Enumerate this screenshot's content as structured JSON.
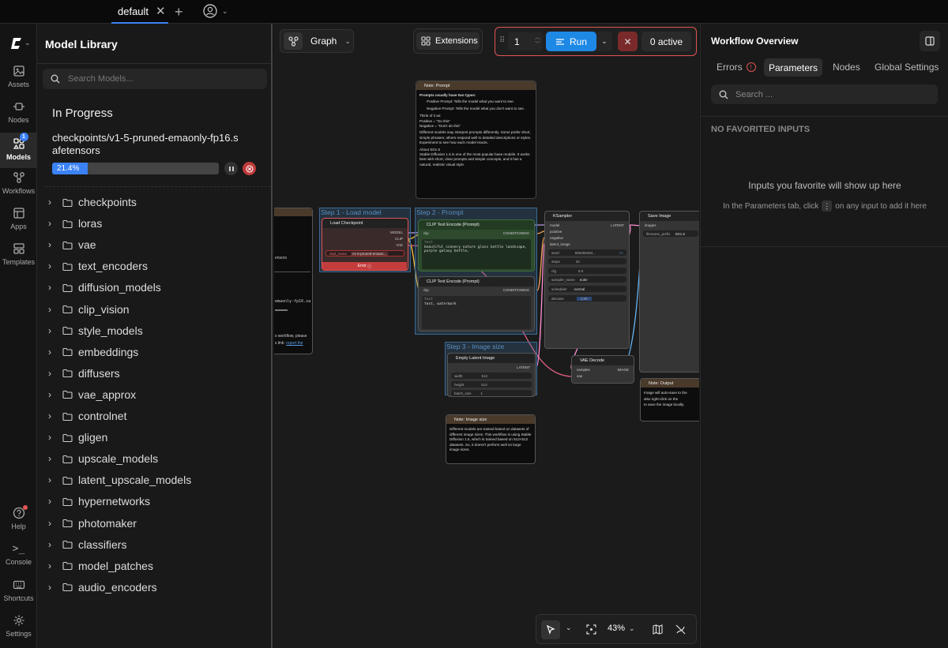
{
  "tabbar": {
    "tab": "default"
  },
  "rail": {
    "items": [
      {
        "label": "Assets",
        "icon": "image-icon"
      },
      {
        "label": "Nodes",
        "icon": "node-icon"
      },
      {
        "label": "Models",
        "icon": "models-icon",
        "badge": "1"
      },
      {
        "label": "Workflows",
        "icon": "workflow-icon"
      },
      {
        "label": "Apps",
        "icon": "apps-icon"
      },
      {
        "label": "Templates",
        "icon": "templates-icon"
      }
    ],
    "bottom": [
      {
        "label": "Help",
        "icon": "help-icon"
      },
      {
        "label": "Console",
        "icon": "console-icon"
      },
      {
        "label": "Shortcuts",
        "icon": "keyboard-icon"
      },
      {
        "label": "Settings",
        "icon": "gear-icon"
      }
    ]
  },
  "library": {
    "title": "Model Library",
    "search_placeholder": "Search Models...",
    "progress_heading": "In Progress",
    "download_name": "checkpoints/v1-5-pruned-emaonly-fp16.safetensors",
    "download_percent": "21.4%",
    "download_fraction": 0.214,
    "folders": [
      "checkpoints",
      "loras",
      "vae",
      "text_encoders",
      "diffusion_models",
      "clip_vision",
      "style_models",
      "embeddings",
      "diffusers",
      "vae_approx",
      "controlnet",
      "gligen",
      "upscale_models",
      "latent_upscale_models",
      "hypernetworks",
      "photomaker",
      "classifiers",
      "model_patches",
      "audio_encoders"
    ]
  },
  "canvas": {
    "graph_label": "Graph",
    "extensions_label": "Extensions",
    "run_count": "1",
    "run_label": "Run",
    "active_label": "0 active",
    "zoom": "43%",
    "groups": {
      "g1": "Step 1 - Load model",
      "g2": "Step 2 - Prompt",
      "g3": "Step 3 - Image size"
    },
    "note_prompt": {
      "title": "Note: Prompt",
      "heading": "Prompts usually have two types:",
      "pos": "Positive Prompt: Tells the model what you want to see.",
      "neg": "Negative Prompt: Tells the model what you don't want to see.",
      "think": "Think of it as:",
      "pos2": "Positive = \"Do this\"",
      "neg2": "Negative = \"Don't do this\"",
      "body": "Different models may interpret prompts differently. Some prefer short, simple phrases; others respond well to detailed descriptions or styles. Experiment to see how each model reacts.",
      "about": "About SD1.5",
      "about_body": "Stable Diffusion 1.5 is one of the most popular base models. It works best with short, clear prompts and simple concepts, and it has a natural, realistic visual style."
    },
    "load_ckpt": {
      "title": "Load Checkpoint",
      "out1": "MODEL",
      "out2": "CLIP",
      "out3": "VAE",
      "w_label": "ckpt_name",
      "w_value": "v1-5-pruned-emaon...",
      "error": "Error"
    },
    "clip1": {
      "title": "CLIP Text Encode (Prompt)",
      "in": "clip",
      "out": "CONDITIONING",
      "text_label": "text",
      "text": "beautiful scenery nature glass bottle landscape, purple galaxy bottle,"
    },
    "clip2": {
      "title": "CLIP Text Encode (Prompt)",
      "in": "clip",
      "out": "CONDITIONING",
      "text_label": "text",
      "text": "text, watermark"
    },
    "ksampler": {
      "title": "KSampler",
      "ins": [
        "model",
        "positive",
        "negative",
        "latent_image"
      ],
      "out": "LATENT",
      "widgets": [
        [
          "seed",
          "585458484..."
        ],
        [
          "steps",
          "20"
        ],
        [
          "cfg",
          "8.0"
        ],
        [
          "sampler_name",
          "euler"
        ],
        [
          "scheduler",
          "normal"
        ],
        [
          "denoise",
          "1.00"
        ]
      ]
    },
    "save": {
      "title": "Save Image",
      "in": "images",
      "w_label": "filename_prefix",
      "w_value": "SD1.5"
    },
    "latent": {
      "title": "Empty Latent Image",
      "out": "LATENT",
      "widgets": [
        [
          "width",
          "512"
        ],
        [
          "height",
          "512"
        ],
        [
          "batch_size",
          "1"
        ]
      ]
    },
    "vae": {
      "title": "VAE Decode",
      "ins": [
        "samples",
        "vae"
      ],
      "out": "IMAGE"
    },
    "note_output": {
      "title": "Note: Output",
      "l1": "Image will auto-save to the",
      "l2": "also right-click on the",
      "l3": "to save the image locally."
    },
    "note_size": {
      "title": "Note: Image size",
      "body": "Different models are trained based on datasets of different image sizes. This workflow is using Stable Diffusion 1.5, which is trained based on 512×512 datasets. So, it doesn't perform well on large image sizes."
    },
    "partial": {
      "l1": "ensors",
      "l2": "emaonly-fp16.sa",
      "l3": "s workflow, please",
      "l4": "s link:",
      "l5": "report the"
    }
  },
  "overview": {
    "title": "Workflow Overview",
    "tabs": [
      "Errors",
      "Parameters",
      "Nodes",
      "Global Settings"
    ],
    "search_placeholder": "Search ...",
    "section": "NO FAVORITED INPUTS",
    "empty_title": "Inputs you favorite will show up here",
    "empty_hint_a": "In the Parameters tab, click",
    "empty_hint_b": "on any input to add it here"
  },
  "colors": {
    "accent": "#3b82f6",
    "run": "#1e88e5",
    "danger": "#e05555",
    "group": "#3e78aa"
  }
}
